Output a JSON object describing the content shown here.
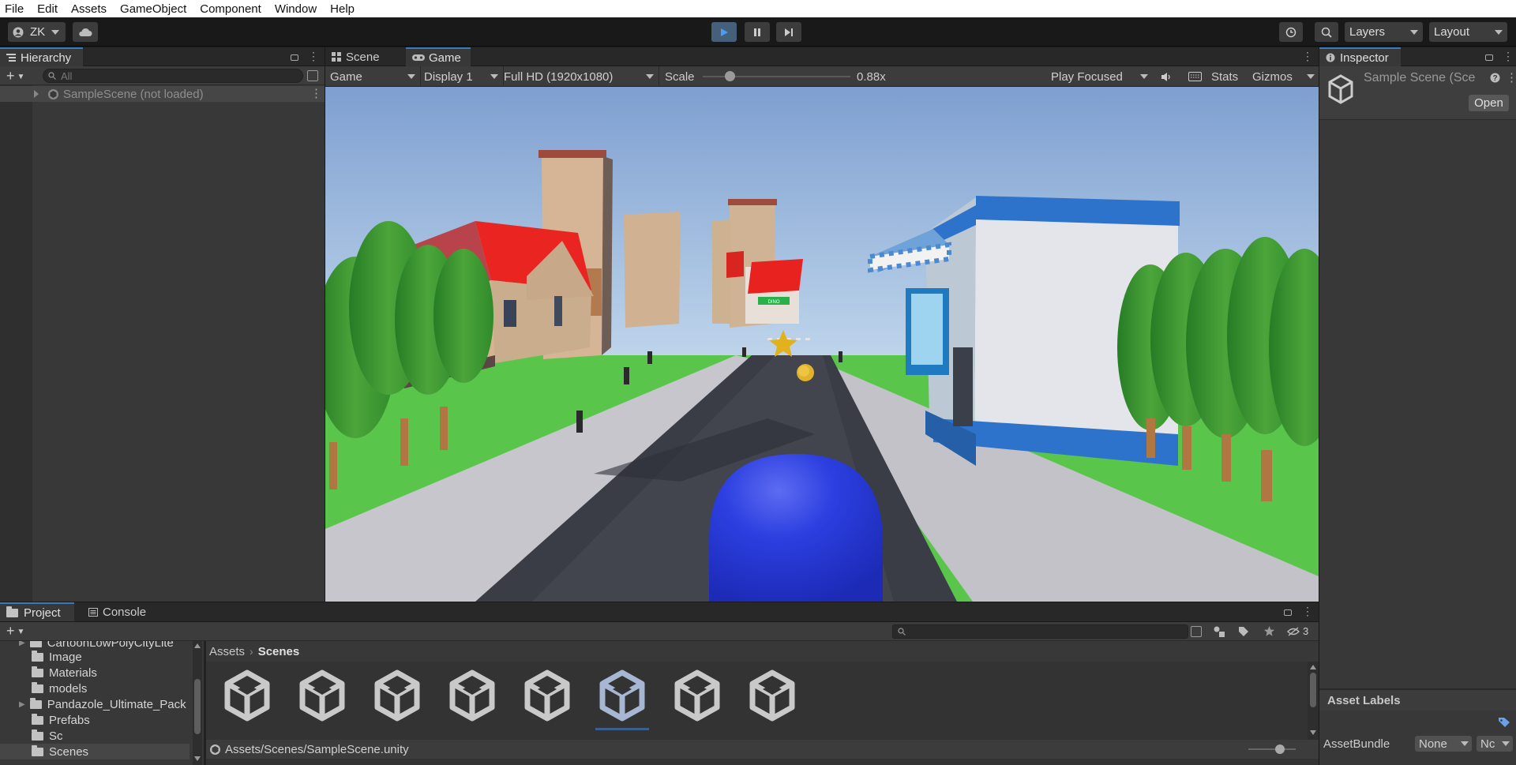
{
  "menu": [
    "File",
    "Edit",
    "Assets",
    "GameObject",
    "Component",
    "Window",
    "Help"
  ],
  "toolbar": {
    "account": "ZK",
    "layers": "Layers",
    "layout": "Layout"
  },
  "hierarchy": {
    "tab": "Hierarchy",
    "search_placeholder": "All",
    "scene_item": "SampleScene (not loaded)"
  },
  "view_tabs": {
    "scene": "Scene",
    "game": "Game"
  },
  "game_bar": {
    "mode": "Game",
    "display": "Display 1",
    "resolution": "Full HD (1920x1080)",
    "scale_label": "Scale",
    "scale_value": "0.88x",
    "scale_fraction": 0.18,
    "play_focused": "Play Focused",
    "stats": "Stats",
    "gizmos": "Gizmos"
  },
  "game_view": {
    "sign_text": "DINO"
  },
  "inspector": {
    "tab": "Inspector",
    "title": "Sample Scene (Sce",
    "open_button": "Open",
    "asset_labels": "Asset Labels",
    "assetbundle_label": "AssetBundle",
    "assetbundle_value": "None",
    "assetbundle_variant": "Nc"
  },
  "project": {
    "tab_project": "Project",
    "tab_console": "Console",
    "folders": [
      "CartoonLowPolyCityLite",
      "Image",
      "Materials",
      "models",
      "Pandazole_Ultimate_Pack",
      "Prefabs",
      "Sc",
      "Scenes"
    ],
    "breadcrumb": [
      "Assets",
      "Scenes"
    ],
    "hidden_count": "3",
    "path": "Assets/Scenes/SampleScene.unity",
    "asset_count": 8
  }
}
